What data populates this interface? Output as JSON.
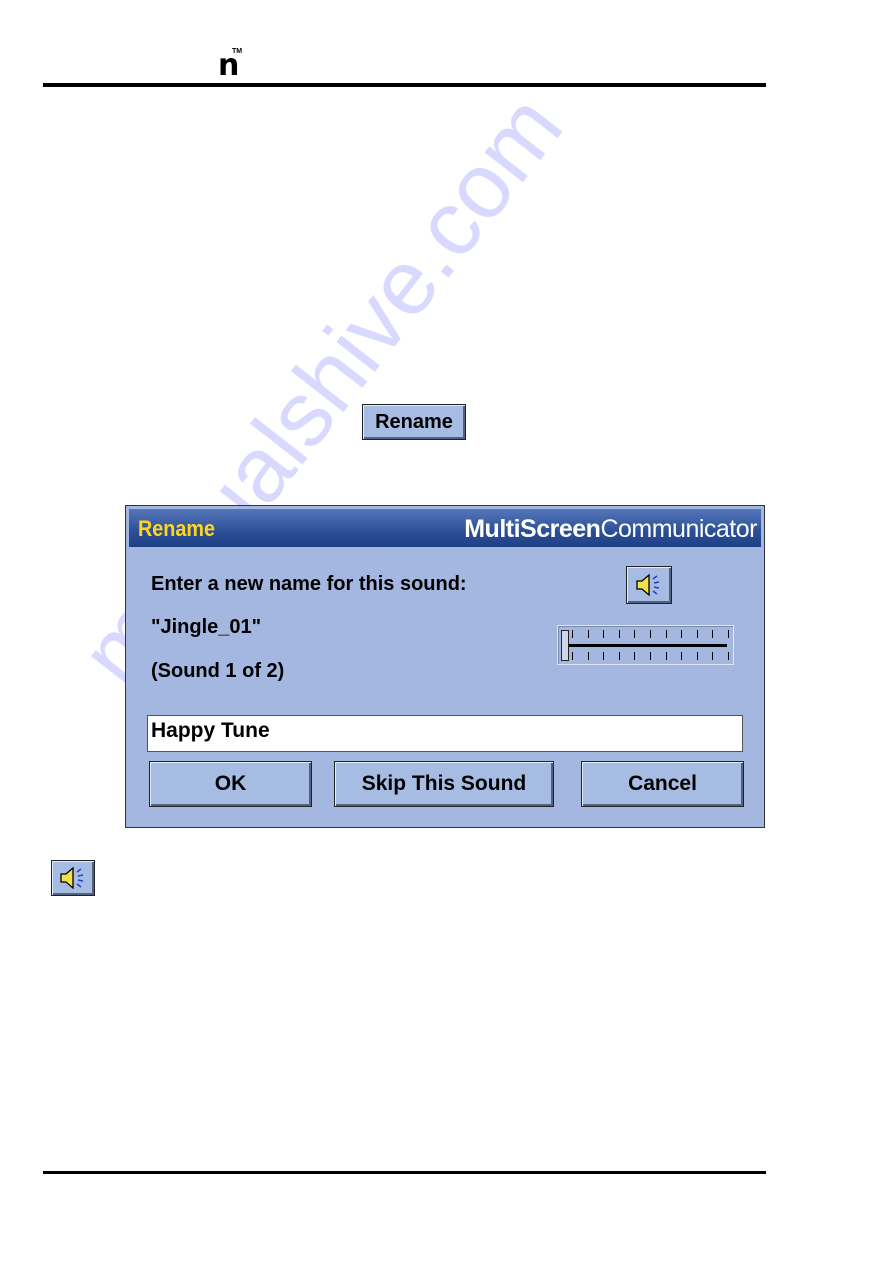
{
  "header": {
    "logo_text": "n",
    "trademark": "TM"
  },
  "body": {
    "rename_button_label": "Rename"
  },
  "dialog": {
    "title": "Rename",
    "brand_bold": "MultiScreen",
    "brand_regular": "Communicator",
    "prompt": "Enter a new name for this sound:",
    "sound_name": "\"Jingle_01\"",
    "sound_count": "(Sound 1 of 2)",
    "name_input_value": "Happy Tune",
    "volume_level": 0,
    "buttons": {
      "ok": "OK",
      "skip": "Skip This Sound",
      "cancel": "Cancel"
    },
    "play_icon": "speaker-icon"
  },
  "watermark": "manualshive.com",
  "colors": {
    "dialog_bg": "#a3b7e0",
    "titlebar": "#2b4f97",
    "title_text": "#ffd61c"
  }
}
